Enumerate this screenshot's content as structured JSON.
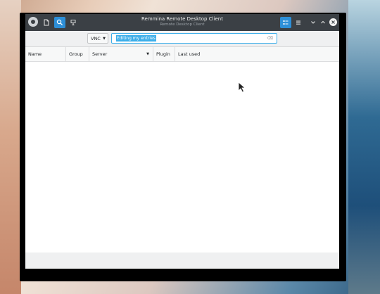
{
  "window": {
    "title": "Remmina Remote Desktop Client",
    "subtitle": "Remote Desktop Client"
  },
  "titlebar": {
    "left_buttons": [
      {
        "name": "app-menu-icon"
      },
      {
        "name": "new-connection-icon"
      },
      {
        "name": "search-icon",
        "active": true
      },
      {
        "name": "quick-connect-icon"
      }
    ],
    "right_buttons": [
      {
        "name": "view-toggle-icon",
        "active": true
      },
      {
        "name": "hamburger-menu-icon"
      },
      {
        "name": "minimize-icon"
      },
      {
        "name": "maximize-icon"
      },
      {
        "name": "close-icon"
      }
    ]
  },
  "toolbar": {
    "protocol": "VNC",
    "search_value": "Editing my entries"
  },
  "table": {
    "columns": [
      "Name",
      "Group",
      "Server",
      "Plugin",
      "Last used"
    ],
    "sorted_column": "Server",
    "rows": []
  },
  "colors": {
    "titlebar": "#3b4045",
    "accent": "#3daee9",
    "active_button": "#2d8fd8"
  }
}
